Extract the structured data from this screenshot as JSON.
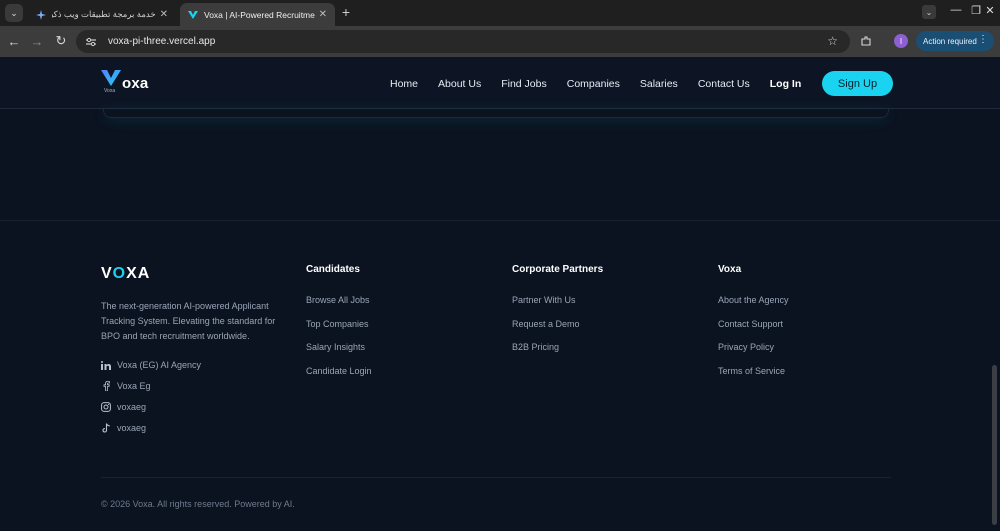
{
  "browser": {
    "tabs": [
      {
        "title": "خدمة برمجة تطبيقات ويب ذكية ...",
        "favicon": "sparkle-icon",
        "active": false
      },
      {
        "title": "Voxa | AI-Powered Recruitment",
        "favicon": "voxa-logo-icon",
        "active": true
      }
    ],
    "url": "voxa-pi-three.vercel.app",
    "profile_initial": "I",
    "action_label": "Action required"
  },
  "navbar": {
    "logo_text": "oxa",
    "logo_small": "Voxa",
    "links": [
      "Home",
      "About Us",
      "Find Jobs",
      "Companies",
      "Salaries",
      "Contact Us"
    ],
    "login": "Log In",
    "signup": "Sign Up"
  },
  "footer": {
    "brand_pre": "V",
    "brand_o": "O",
    "brand_post": "XA",
    "description": "The next-generation AI-powered Applicant Tracking System. Elevating the standard for BPO and tech recruitment worldwide.",
    "socials": [
      {
        "icon": "linkedin-icon",
        "label": "Voxa (EG) AI Agency"
      },
      {
        "icon": "facebook-icon",
        "label": "Voxa Eg"
      },
      {
        "icon": "instagram-icon",
        "label": "voxaeg"
      },
      {
        "icon": "tiktok-icon",
        "label": "voxaeg"
      }
    ],
    "columns": [
      {
        "heading": "Candidates",
        "links": [
          "Browse All Jobs",
          "Top Companies",
          "Salary Insights",
          "Candidate Login"
        ]
      },
      {
        "heading": "Corporate Partners",
        "links": [
          "Partner With Us",
          "Request a Demo",
          "B2B Pricing"
        ]
      },
      {
        "heading": "Voxa",
        "links": [
          "About the Agency",
          "Contact Support",
          "Privacy Policy",
          "Terms of Service"
        ]
      }
    ],
    "copyright": "© 2026 Voxa. All rights reserved. Powered by AI."
  },
  "colors": {
    "accent": "#19d3f0",
    "background": "#0b1220",
    "navbar": "#0d1524"
  }
}
